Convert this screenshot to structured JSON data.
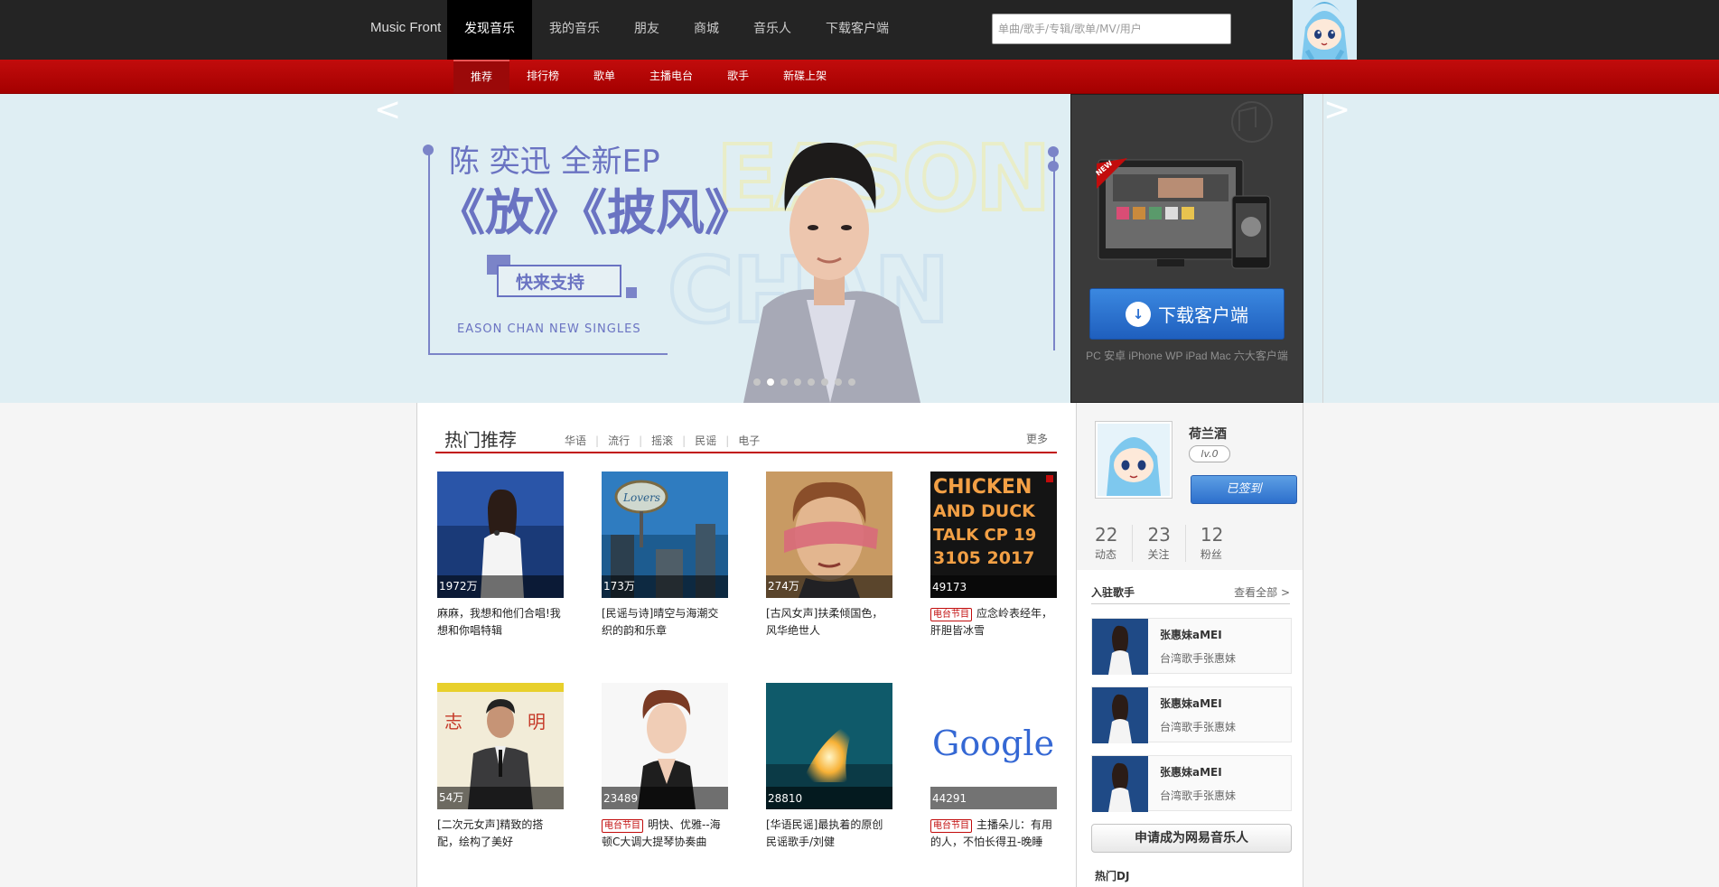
{
  "topnav": {
    "brand": "Music Front",
    "items": [
      "发现音乐",
      "我的音乐",
      "朋友",
      "商城",
      "音乐人",
      "下载客户端"
    ],
    "search_placeholder": "单曲/歌手/专辑/歌单/MV/用户"
  },
  "subnav": {
    "items": [
      "推荐",
      "排行榜",
      "歌单",
      "主播电台",
      "歌手",
      "新碟上架"
    ]
  },
  "banner": {
    "arrow_left": "<",
    "arrow_right": ">",
    "headline": "陈 奕迅  全新EP",
    "title": "《放》《披风》",
    "cta": "快来支持",
    "subtitle": "EASON CHAN NEW SINGLES",
    "bg_text_1": "EASON",
    "bg_text_2": "CHAN",
    "active_dot": 2,
    "dot_count": 8
  },
  "download": {
    "new_badge": "NEW",
    "button": "下载客户端",
    "caption": "PC 安卓 iPhone WP iPad Mac 六大客户端"
  },
  "hot": {
    "title": "热门推荐",
    "tags": [
      "华语",
      "流行",
      "摇滚",
      "民谣",
      "电子"
    ],
    "more": "更多",
    "radio_tag": "电台节目",
    "items": [
      {
        "count": "1972万",
        "title": "麻麻，我想和他们合唱!我想和你唱特辑",
        "radio": false
      },
      {
        "count": "173万",
        "title": "[民谣与诗]晴空与海潮交织的韵和乐章",
        "radio": false
      },
      {
        "count": "274万",
        "title": "[古风女声]扶柔倾国色，风华绝世人",
        "radio": false
      },
      {
        "count": "49173",
        "title": "应念岭表经年，肝胆皆冰雪",
        "radio": true
      },
      {
        "count": "54万",
        "title": "[二次元女声]精致的搭配，绘构了美好",
        "radio": false
      },
      {
        "count": "23489",
        "title": "明快、优雅--海顿C大调大提琴协奏曲",
        "radio": true
      },
      {
        "count": "28810",
        "title": "[华语民谣]最执着的原创民谣歌手/刘健",
        "radio": false
      },
      {
        "count": "44291",
        "title": "主播朵儿：有用的人，不怕长得丑-晚睡",
        "radio": true
      }
    ],
    "cover_texts": {
      "chicken": [
        "CHICKEN",
        "AND DUCK",
        "TALK CP 19",
        "3105 2017"
      ],
      "google": "Google",
      "zhiming": [
        "志",
        "明"
      ],
      "lover": "Lovers"
    }
  },
  "user": {
    "name": "荷兰酒",
    "level": "lv.0",
    "signed": "已签到",
    "stats": [
      {
        "num": "22",
        "label": "动态"
      },
      {
        "num": "23",
        "label": "关注"
      },
      {
        "num": "12",
        "label": "粉丝"
      }
    ]
  },
  "singers": {
    "title": "入驻歌手",
    "view_all": "查看全部 >",
    "items": [
      {
        "name": "张惠妹aMEI",
        "desc": "台湾歌手张惠妹"
      },
      {
        "name": "张惠妹aMEI",
        "desc": "台湾歌手张惠妹"
      },
      {
        "name": "张惠妹aMEI",
        "desc": "台湾歌手张惠妹"
      }
    ]
  },
  "apply_button": "申请成为网易音乐人",
  "hot_dj": "热门DJ",
  "colors": {
    "topbar": "#242424",
    "brand_red": "#c20c0c",
    "download_blue": "#2a6fd0"
  }
}
